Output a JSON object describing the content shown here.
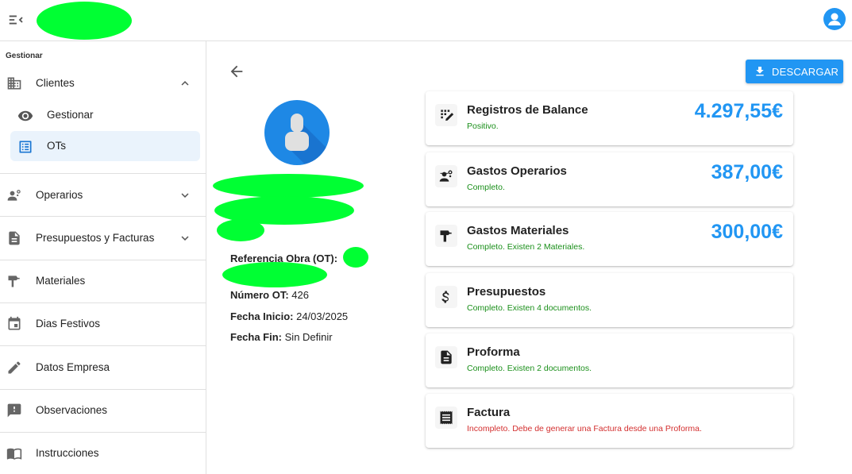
{
  "sidebar": {
    "section_label": "Gestionar",
    "clientes": "Clientes",
    "sub_gestionar": "Gestionar",
    "sub_ots": "OTs",
    "operarios": "Operarios",
    "presupuestos": "Presupuestos y Facturas",
    "materiales": "Materiales",
    "dias_festivos": "Dias Festivos",
    "datos_empresa": "Datos Empresa",
    "observaciones": "Observaciones",
    "instrucciones": "Instrucciones"
  },
  "toolbar": {
    "download_label": "DESCARGAR"
  },
  "details": {
    "ref_label": "Referencia Obra (OT):",
    "ot_label": "Número OT:",
    "ot_value": "426",
    "start_label": "Fecha Inicio:",
    "start_value": "24/03/2025",
    "end_label": "Fecha Fin:",
    "end_value": "Sin Definir"
  },
  "cards": [
    {
      "title": "Registros de Balance",
      "status": "Positivo.",
      "status_color": "#1a8f1a",
      "amount": "4.297,55€",
      "icon": "balance-icon"
    },
    {
      "title": "Gastos Operarios",
      "status": "Completo.",
      "status_color": "#1a8f1a",
      "amount": "387,00€",
      "icon": "workers-icon"
    },
    {
      "title": "Gastos Materiales",
      "status": "Completo. Existen 2 Materiales.",
      "status_color": "#1a8f1a",
      "amount": "300,00€",
      "icon": "hammer-icon"
    },
    {
      "title": "Presupuestos",
      "status": "Completo. Existen 4 documentos.",
      "status_color": "#1a8f1a",
      "amount": "",
      "icon": "dollar-icon"
    },
    {
      "title": "Proforma",
      "status": "Completo. Existen 2 documentos.",
      "status_color": "#1a8f1a",
      "amount": "",
      "icon": "document-icon"
    },
    {
      "title": "Factura",
      "status": "Incompleto. Debe de generar una Factura desde una Proforma.",
      "status_color": "#d32f2f",
      "amount": "",
      "icon": "receipt-icon"
    }
  ],
  "colors": {
    "accent": "#2196f3",
    "active_bg": "#eaf3fc",
    "success": "#1a8f1a",
    "error": "#d32f2f",
    "redaction": "#00ff33"
  }
}
